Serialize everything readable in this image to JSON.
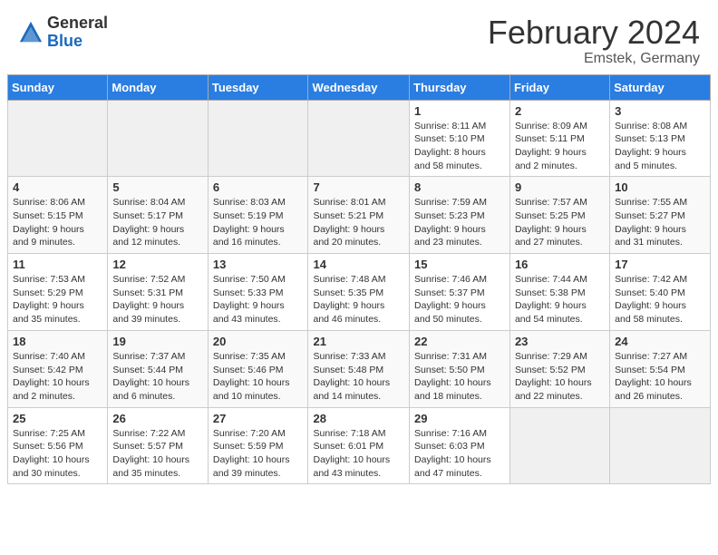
{
  "header": {
    "logo_general": "General",
    "logo_blue": "Blue",
    "month_title": "February 2024",
    "location": "Emstek, Germany"
  },
  "columns": [
    "Sunday",
    "Monday",
    "Tuesday",
    "Wednesday",
    "Thursday",
    "Friday",
    "Saturday"
  ],
  "weeks": [
    [
      {
        "day": "",
        "info": ""
      },
      {
        "day": "",
        "info": ""
      },
      {
        "day": "",
        "info": ""
      },
      {
        "day": "",
        "info": ""
      },
      {
        "day": "1",
        "info": "Sunrise: 8:11 AM\nSunset: 5:10 PM\nDaylight: 8 hours\nand 58 minutes."
      },
      {
        "day": "2",
        "info": "Sunrise: 8:09 AM\nSunset: 5:11 PM\nDaylight: 9 hours\nand 2 minutes."
      },
      {
        "day": "3",
        "info": "Sunrise: 8:08 AM\nSunset: 5:13 PM\nDaylight: 9 hours\nand 5 minutes."
      }
    ],
    [
      {
        "day": "4",
        "info": "Sunrise: 8:06 AM\nSunset: 5:15 PM\nDaylight: 9 hours\nand 9 minutes."
      },
      {
        "day": "5",
        "info": "Sunrise: 8:04 AM\nSunset: 5:17 PM\nDaylight: 9 hours\nand 12 minutes."
      },
      {
        "day": "6",
        "info": "Sunrise: 8:03 AM\nSunset: 5:19 PM\nDaylight: 9 hours\nand 16 minutes."
      },
      {
        "day": "7",
        "info": "Sunrise: 8:01 AM\nSunset: 5:21 PM\nDaylight: 9 hours\nand 20 minutes."
      },
      {
        "day": "8",
        "info": "Sunrise: 7:59 AM\nSunset: 5:23 PM\nDaylight: 9 hours\nand 23 minutes."
      },
      {
        "day": "9",
        "info": "Sunrise: 7:57 AM\nSunset: 5:25 PM\nDaylight: 9 hours\nand 27 minutes."
      },
      {
        "day": "10",
        "info": "Sunrise: 7:55 AM\nSunset: 5:27 PM\nDaylight: 9 hours\nand 31 minutes."
      }
    ],
    [
      {
        "day": "11",
        "info": "Sunrise: 7:53 AM\nSunset: 5:29 PM\nDaylight: 9 hours\nand 35 minutes."
      },
      {
        "day": "12",
        "info": "Sunrise: 7:52 AM\nSunset: 5:31 PM\nDaylight: 9 hours\nand 39 minutes."
      },
      {
        "day": "13",
        "info": "Sunrise: 7:50 AM\nSunset: 5:33 PM\nDaylight: 9 hours\nand 43 minutes."
      },
      {
        "day": "14",
        "info": "Sunrise: 7:48 AM\nSunset: 5:35 PM\nDaylight: 9 hours\nand 46 minutes."
      },
      {
        "day": "15",
        "info": "Sunrise: 7:46 AM\nSunset: 5:37 PM\nDaylight: 9 hours\nand 50 minutes."
      },
      {
        "day": "16",
        "info": "Sunrise: 7:44 AM\nSunset: 5:38 PM\nDaylight: 9 hours\nand 54 minutes."
      },
      {
        "day": "17",
        "info": "Sunrise: 7:42 AM\nSunset: 5:40 PM\nDaylight: 9 hours\nand 58 minutes."
      }
    ],
    [
      {
        "day": "18",
        "info": "Sunrise: 7:40 AM\nSunset: 5:42 PM\nDaylight: 10 hours\nand 2 minutes."
      },
      {
        "day": "19",
        "info": "Sunrise: 7:37 AM\nSunset: 5:44 PM\nDaylight: 10 hours\nand 6 minutes."
      },
      {
        "day": "20",
        "info": "Sunrise: 7:35 AM\nSunset: 5:46 PM\nDaylight: 10 hours\nand 10 minutes."
      },
      {
        "day": "21",
        "info": "Sunrise: 7:33 AM\nSunset: 5:48 PM\nDaylight: 10 hours\nand 14 minutes."
      },
      {
        "day": "22",
        "info": "Sunrise: 7:31 AM\nSunset: 5:50 PM\nDaylight: 10 hours\nand 18 minutes."
      },
      {
        "day": "23",
        "info": "Sunrise: 7:29 AM\nSunset: 5:52 PM\nDaylight: 10 hours\nand 22 minutes."
      },
      {
        "day": "24",
        "info": "Sunrise: 7:27 AM\nSunset: 5:54 PM\nDaylight: 10 hours\nand 26 minutes."
      }
    ],
    [
      {
        "day": "25",
        "info": "Sunrise: 7:25 AM\nSunset: 5:56 PM\nDaylight: 10 hours\nand 30 minutes."
      },
      {
        "day": "26",
        "info": "Sunrise: 7:22 AM\nSunset: 5:57 PM\nDaylight: 10 hours\nand 35 minutes."
      },
      {
        "day": "27",
        "info": "Sunrise: 7:20 AM\nSunset: 5:59 PM\nDaylight: 10 hours\nand 39 minutes."
      },
      {
        "day": "28",
        "info": "Sunrise: 7:18 AM\nSunset: 6:01 PM\nDaylight: 10 hours\nand 43 minutes."
      },
      {
        "day": "29",
        "info": "Sunrise: 7:16 AM\nSunset: 6:03 PM\nDaylight: 10 hours\nand 47 minutes."
      },
      {
        "day": "",
        "info": ""
      },
      {
        "day": "",
        "info": ""
      }
    ]
  ]
}
